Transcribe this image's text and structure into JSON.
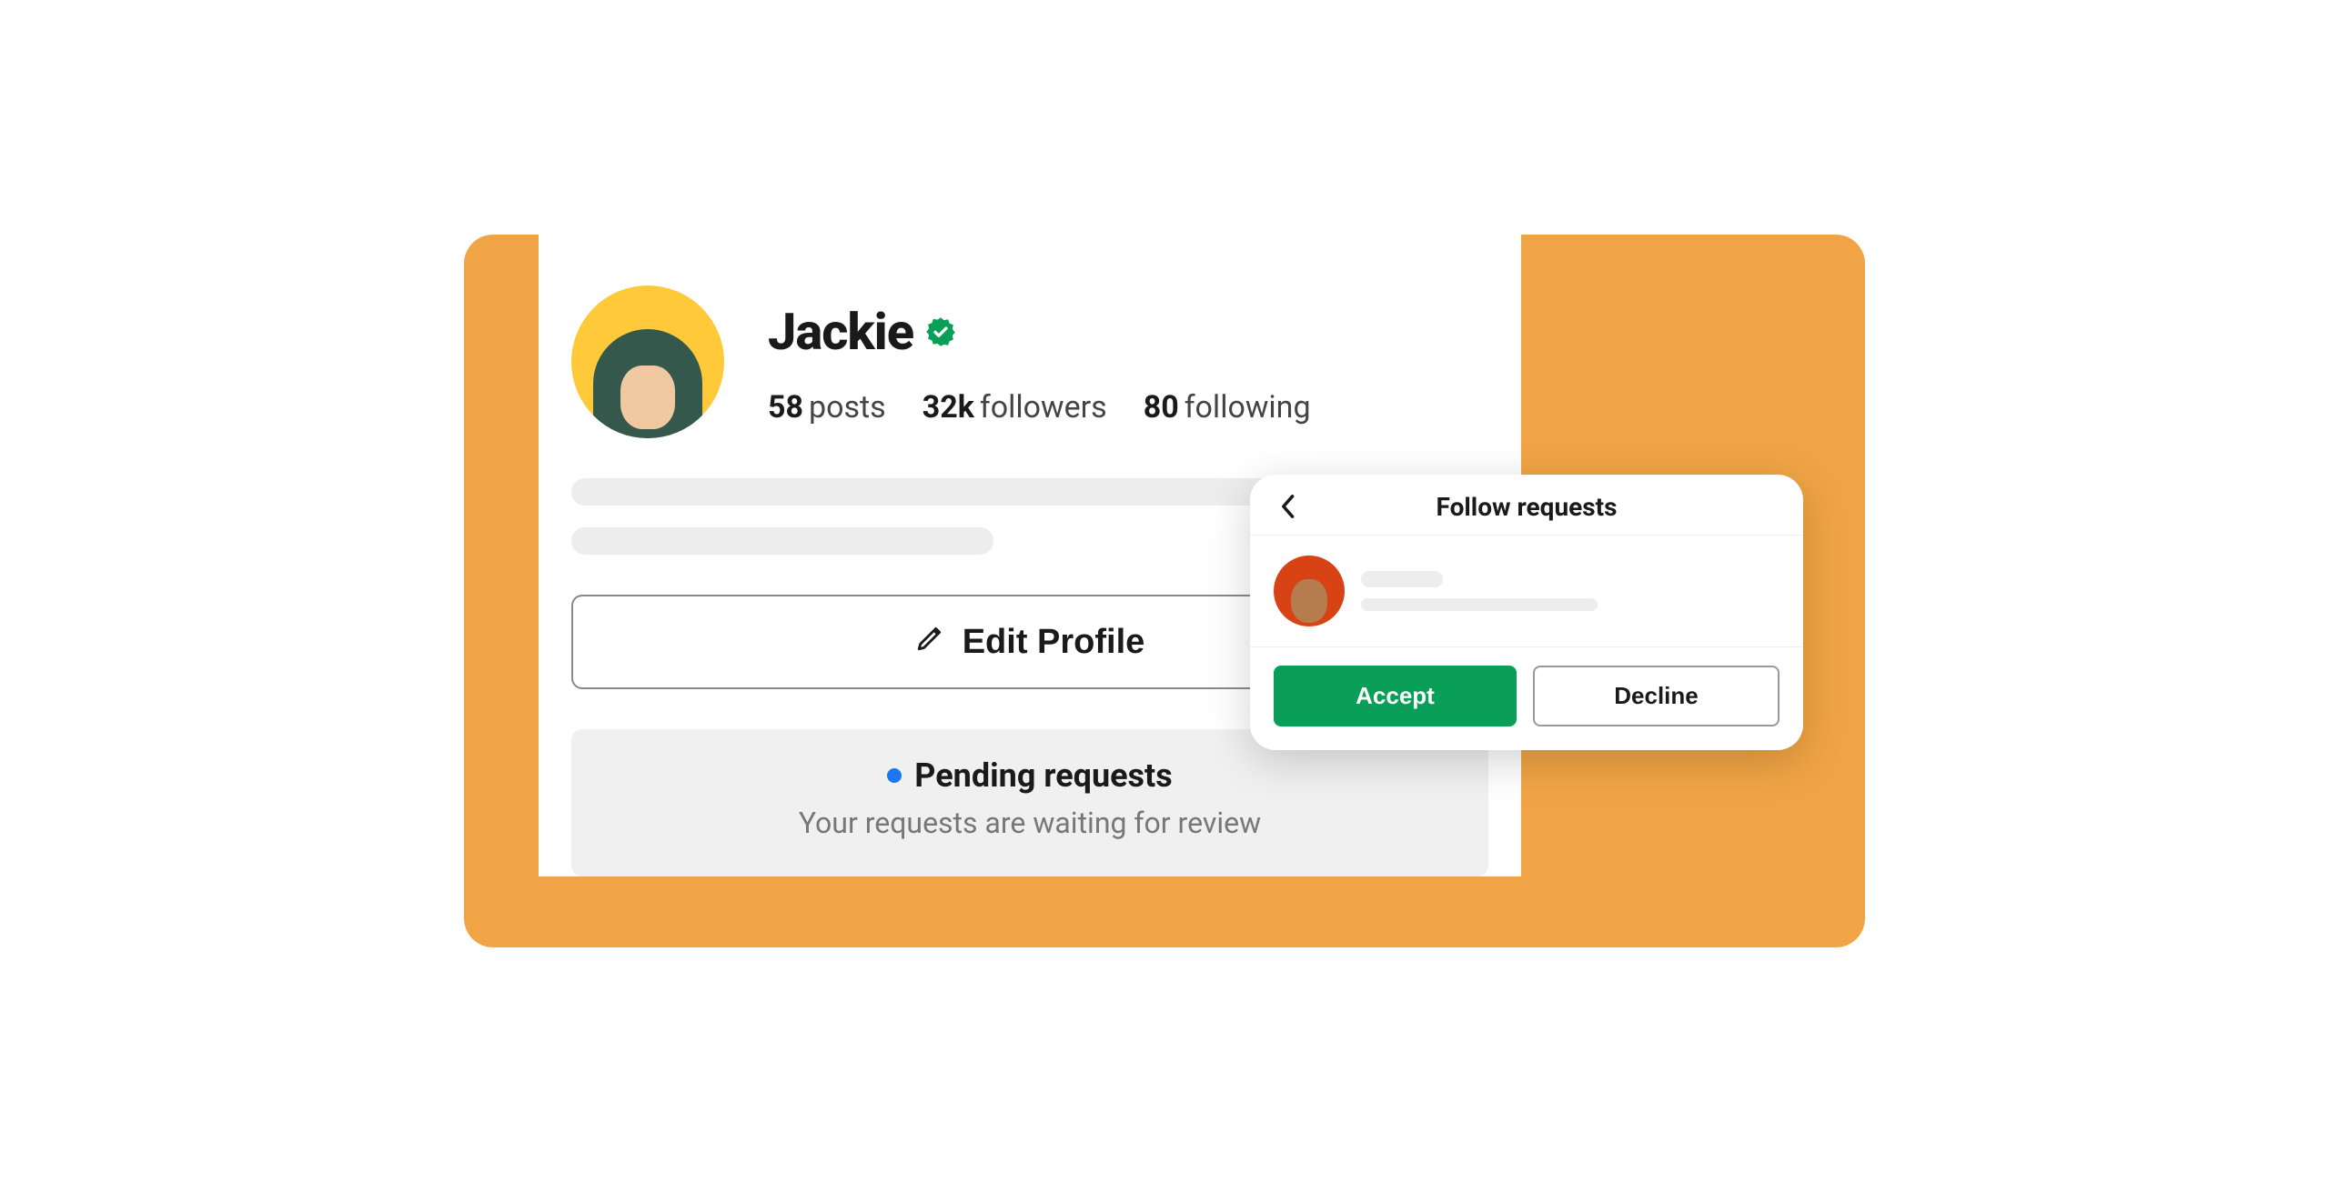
{
  "profile": {
    "name": "Jackie",
    "stats": {
      "posts_count": "58",
      "posts_label": "posts",
      "followers_count": "32k",
      "followers_label": "followers",
      "following_count": "80",
      "following_label": "following"
    },
    "edit_button_label": "Edit Profile",
    "pending": {
      "title": "Pending requests",
      "subtitle": "Your requests are waiting for review"
    }
  },
  "follow_modal": {
    "title": "Follow requests",
    "accept_label": "Accept",
    "decline_label": "Decline"
  },
  "colors": {
    "accent_green": "#0a9f59",
    "verified_green": "#0a9f59",
    "notification_blue": "#1877f2",
    "background_orange": "#f0a445"
  }
}
